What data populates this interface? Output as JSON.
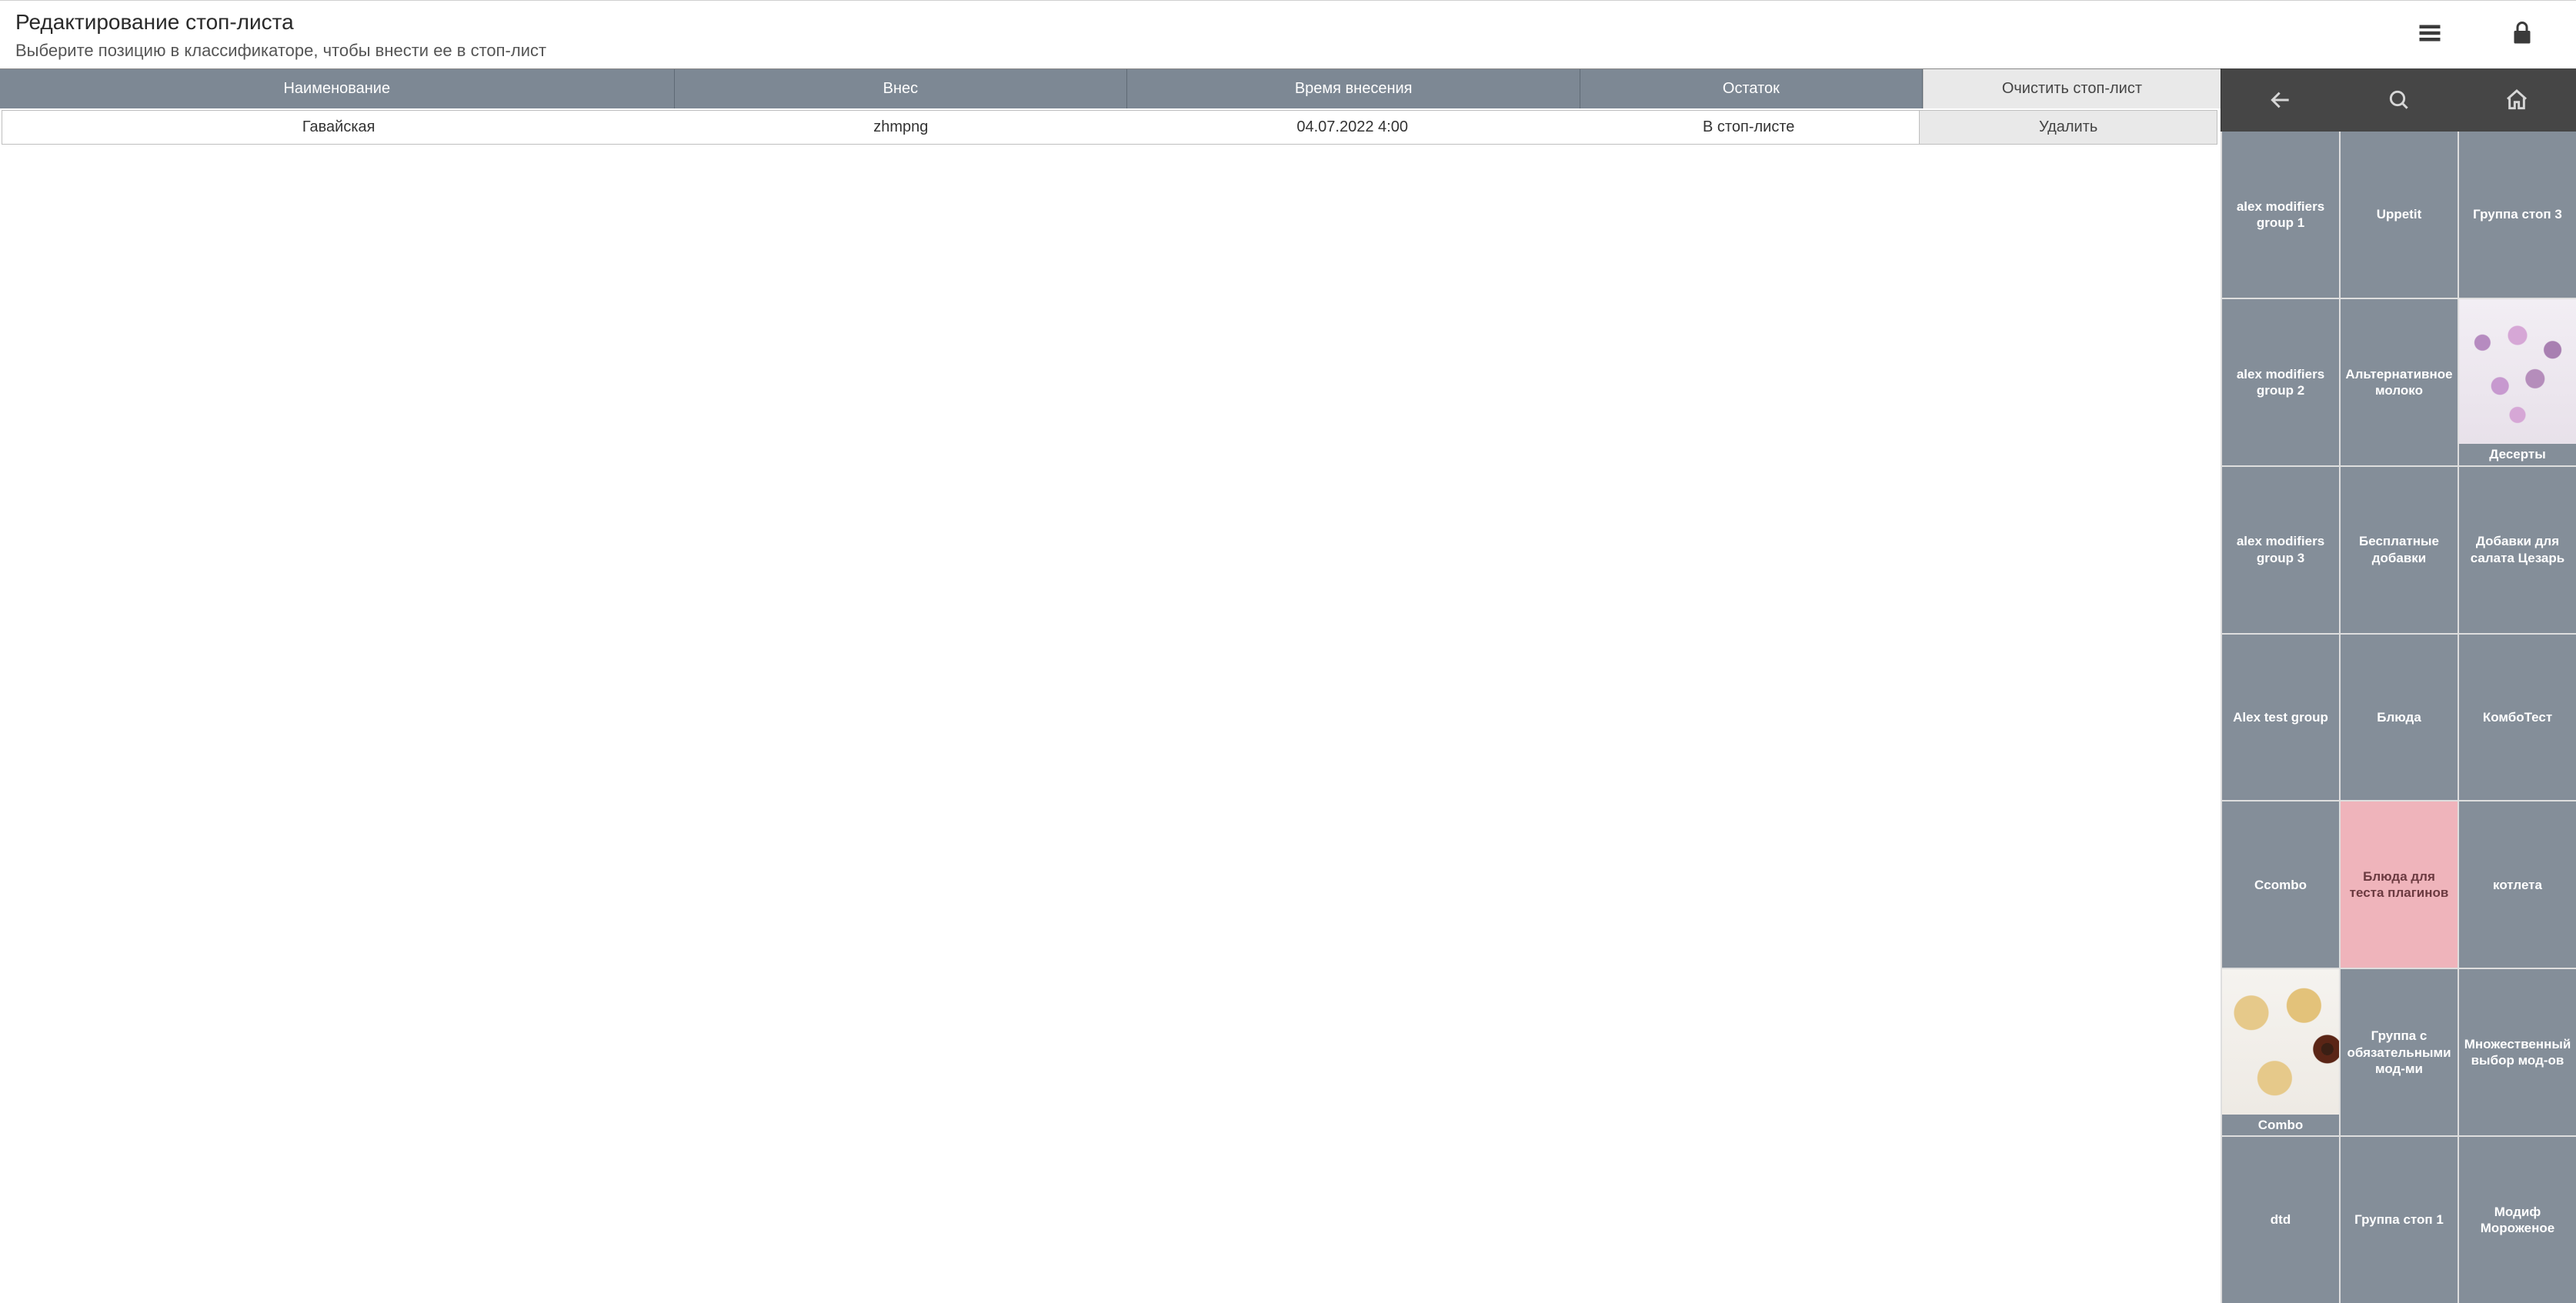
{
  "header": {
    "title": "Редактирование стоп-листа",
    "subtitle": "Выберите позицию в классификаторе, чтобы внести ее в стоп-лист"
  },
  "table": {
    "columns": {
      "name": "Наименование",
      "user": "Внес",
      "time": "Время внесения",
      "rest": "Остаток",
      "action_header": "Очистить стоп-лист"
    },
    "rows": [
      {
        "name": "Гавайская",
        "user": "zhmpng",
        "time": "04.07.2022 4:00",
        "rest": "В стоп-листе",
        "action": "Удалить"
      }
    ]
  },
  "catalog": {
    "tiles": [
      {
        "label": "alex modifiers group 1",
        "style": "normal"
      },
      {
        "label": "Uppetit",
        "style": "normal"
      },
      {
        "label": "Группа стоп 3",
        "style": "normal"
      },
      {
        "label": "alex modifiers group 2",
        "style": "normal"
      },
      {
        "label": "Альтернативное молоко",
        "style": "normal"
      },
      {
        "label": "Десерты",
        "style": "image",
        "image": "berries"
      },
      {
        "label": "alex modifiers group 3",
        "style": "normal"
      },
      {
        "label": "Бесплатные добавки",
        "style": "normal"
      },
      {
        "label": "Добавки для салата Цезарь",
        "style": "normal"
      },
      {
        "label": "Alex test group",
        "style": "normal"
      },
      {
        "label": "Блюда",
        "style": "normal"
      },
      {
        "label": "КомбоТест",
        "style": "normal"
      },
      {
        "label": "Ccombo",
        "style": "normal"
      },
      {
        "label": "Блюда для теста плагинов",
        "style": "pink"
      },
      {
        "label": "котлета",
        "style": "normal"
      },
      {
        "label": "Combo",
        "style": "image",
        "image": "pizza"
      },
      {
        "label": "Группа с обязательными мод-ми",
        "style": "normal"
      },
      {
        "label": "Множественный выбор мод-ов",
        "style": "normal"
      },
      {
        "label": "dtd",
        "style": "normal"
      },
      {
        "label": "Группа стоп 1",
        "style": "normal"
      },
      {
        "label": "Модиф Мороженое",
        "style": "normal"
      }
    ]
  }
}
